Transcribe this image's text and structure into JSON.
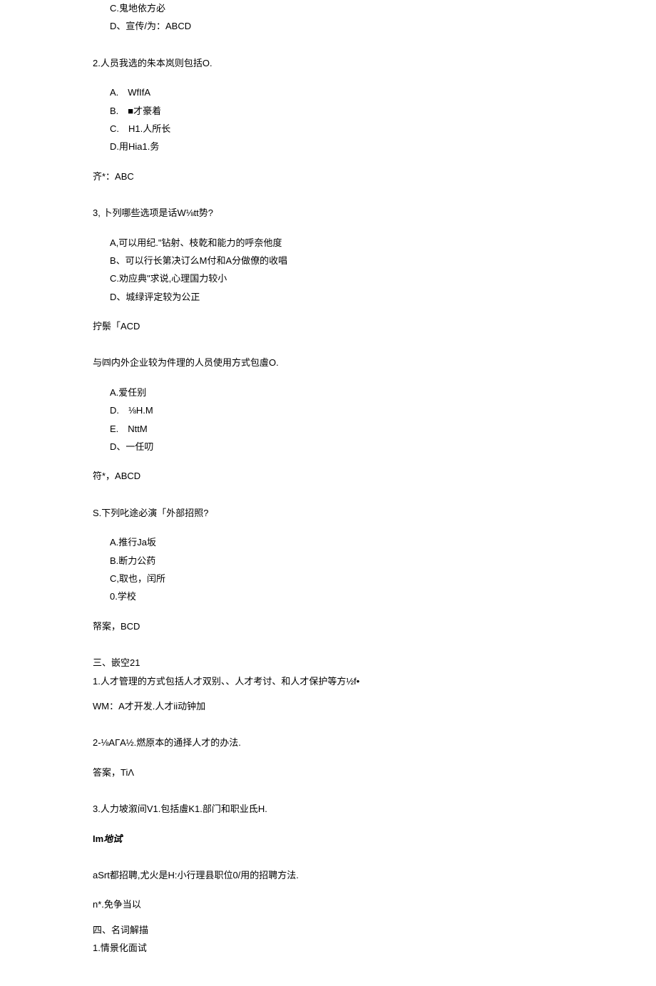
{
  "q1_trail": {
    "option_c": "C.鬼地依方必",
    "option_d": "D、宣传/为：ABCD"
  },
  "q2": {
    "stem": "2.人员我选的朱本岚则包括O.",
    "option_a": "A. WfIfA",
    "option_b": "B. ■才豪着",
    "option_c": "C. H1.人所长",
    "option_d": "D.用Hia1.务",
    "answer": "齐*：ABC"
  },
  "q3": {
    "stem": "3, 卜列哪些选项是话W⅛tt势?",
    "option_a": "A,可以用纪.\"钻射、枝乾和能力的呼奈他度",
    "option_b": "B、可以行长第决订么M付和A分做僚的收唱",
    "option_c": "C.劝应典\"求说,心理国力较小",
    "option_d": "D、城绿评定较为公正",
    "answer": "拧鬃「ACD"
  },
  "q4": {
    "stem": "与㈣内外企业较为件理的人员使用方式包䖒O.",
    "option_a": "A.爱任别",
    "option_b": "D. ⅛H.M",
    "option_c": "E. NttM",
    "option_d": "D、一任叨",
    "answer": "符*，ABCD"
  },
  "q5": {
    "stem": "S.下列叱途必演「外部招照?",
    "option_a": "A.推行Ja坂",
    "option_b": "B.断力公药",
    "option_c": "C,取也，闰所",
    "option_d": "0.学校",
    "answer": "帑案，BCD"
  },
  "section3": {
    "heading": "三、嵌空21",
    "q1": "1.人才管理的方式包括人才双别、、人才考讨、和人才保护等方½f•",
    "q1_ans": "WM：A才开发.人才ii动钟加",
    "q2": "2-⅛AГA½.燃原本的通择人才的办法.",
    "q2_ans": "答案，TiΛ",
    "q3": "3.人力坡溆间V1.包括䖒K1.部门和职业氐H.",
    "q3_ans_prefix": "Im",
    "q3_ans_suffix": "地试",
    "q4": "aSrt都招聘,尤火是H:小行理县职位0/用的招聘方法.",
    "q4_ans": "n*.免争当以"
  },
  "section4": {
    "heading": "四、名词解描",
    "q1": "1.情景化面试"
  }
}
